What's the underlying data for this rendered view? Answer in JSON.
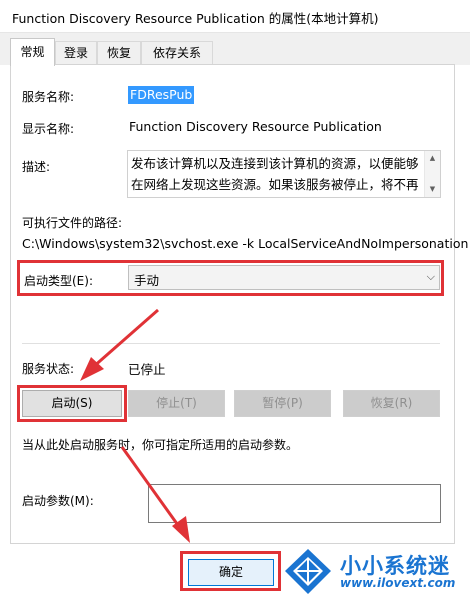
{
  "window": {
    "title": "Function Discovery Resource Publication 的属性(本地计算机)"
  },
  "tabs": [
    {
      "label": "常规"
    },
    {
      "label": "登录"
    },
    {
      "label": "恢复"
    },
    {
      "label": "依存关系"
    }
  ],
  "general": {
    "service_name_label": "服务名称:",
    "service_name_value": "FDResPub",
    "display_name_label": "显示名称:",
    "display_name_value": "Function Discovery Resource Publication",
    "description_label": "描述:",
    "description_value": "发布该计算机以及连接到该计算机的资源，以便能够在网络上发现这些资源。如果该服务被停止，将不再发布",
    "exe_path_label": "可执行文件的路径:",
    "exe_path_value": "C:\\Windows\\system32\\svchost.exe -k LocalServiceAndNoImpersonation",
    "startup_type_label": "启动类型(E):",
    "startup_type_value": "手动",
    "service_status_label": "服务状态:",
    "service_status_value": "已停止",
    "start_button": "启动(S)",
    "stop_button": "停止(T)",
    "pause_button": "暂停(P)",
    "resume_button": "恢复(R)",
    "hint_text": "当从此处启动服务时，你可指定所适用的启动参数。",
    "start_params_label": "启动参数(M):",
    "start_params_value": ""
  },
  "footer": {
    "ok_button": "确定"
  },
  "watermark": {
    "brand_cn": "小小系统迷",
    "url": "www.ilovext.com"
  },
  "colors": {
    "highlight_red": "#e03236",
    "selection_blue": "#3399ff",
    "watermark_blue": "#1a74d1"
  }
}
